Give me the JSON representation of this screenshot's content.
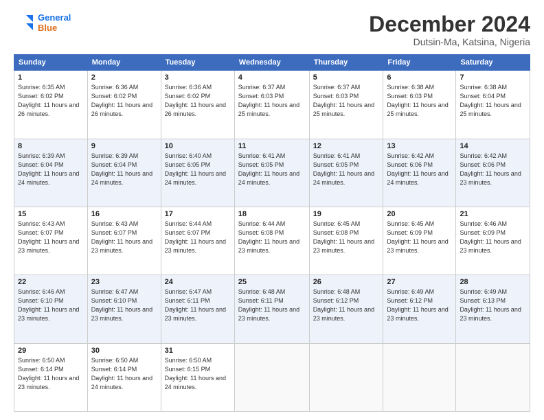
{
  "header": {
    "logo_line1": "General",
    "logo_line2": "Blue",
    "month": "December 2024",
    "location": "Dutsin-Ma, Katsina, Nigeria"
  },
  "days_of_week": [
    "Sunday",
    "Monday",
    "Tuesday",
    "Wednesday",
    "Thursday",
    "Friday",
    "Saturday"
  ],
  "weeks": [
    [
      {
        "day": "1",
        "sunrise": "6:35 AM",
        "sunset": "6:02 PM",
        "daylight": "11 hours and 26 minutes."
      },
      {
        "day": "2",
        "sunrise": "6:36 AM",
        "sunset": "6:02 PM",
        "daylight": "11 hours and 26 minutes."
      },
      {
        "day": "3",
        "sunrise": "6:36 AM",
        "sunset": "6:02 PM",
        "daylight": "11 hours and 26 minutes."
      },
      {
        "day": "4",
        "sunrise": "6:37 AM",
        "sunset": "6:03 PM",
        "daylight": "11 hours and 25 minutes."
      },
      {
        "day": "5",
        "sunrise": "6:37 AM",
        "sunset": "6:03 PM",
        "daylight": "11 hours and 25 minutes."
      },
      {
        "day": "6",
        "sunrise": "6:38 AM",
        "sunset": "6:03 PM",
        "daylight": "11 hours and 25 minutes."
      },
      {
        "day": "7",
        "sunrise": "6:38 AM",
        "sunset": "6:04 PM",
        "daylight": "11 hours and 25 minutes."
      }
    ],
    [
      {
        "day": "8",
        "sunrise": "6:39 AM",
        "sunset": "6:04 PM",
        "daylight": "11 hours and 24 minutes."
      },
      {
        "day": "9",
        "sunrise": "6:39 AM",
        "sunset": "6:04 PM",
        "daylight": "11 hours and 24 minutes."
      },
      {
        "day": "10",
        "sunrise": "6:40 AM",
        "sunset": "6:05 PM",
        "daylight": "11 hours and 24 minutes."
      },
      {
        "day": "11",
        "sunrise": "6:41 AM",
        "sunset": "6:05 PM",
        "daylight": "11 hours and 24 minutes."
      },
      {
        "day": "12",
        "sunrise": "6:41 AM",
        "sunset": "6:05 PM",
        "daylight": "11 hours and 24 minutes."
      },
      {
        "day": "13",
        "sunrise": "6:42 AM",
        "sunset": "6:06 PM",
        "daylight": "11 hours and 24 minutes."
      },
      {
        "day": "14",
        "sunrise": "6:42 AM",
        "sunset": "6:06 PM",
        "daylight": "11 hours and 23 minutes."
      }
    ],
    [
      {
        "day": "15",
        "sunrise": "6:43 AM",
        "sunset": "6:07 PM",
        "daylight": "11 hours and 23 minutes."
      },
      {
        "day": "16",
        "sunrise": "6:43 AM",
        "sunset": "6:07 PM",
        "daylight": "11 hours and 23 minutes."
      },
      {
        "day": "17",
        "sunrise": "6:44 AM",
        "sunset": "6:07 PM",
        "daylight": "11 hours and 23 minutes."
      },
      {
        "day": "18",
        "sunrise": "6:44 AM",
        "sunset": "6:08 PM",
        "daylight": "11 hours and 23 minutes."
      },
      {
        "day": "19",
        "sunrise": "6:45 AM",
        "sunset": "6:08 PM",
        "daylight": "11 hours and 23 minutes."
      },
      {
        "day": "20",
        "sunrise": "6:45 AM",
        "sunset": "6:09 PM",
        "daylight": "11 hours and 23 minutes."
      },
      {
        "day": "21",
        "sunrise": "6:46 AM",
        "sunset": "6:09 PM",
        "daylight": "11 hours and 23 minutes."
      }
    ],
    [
      {
        "day": "22",
        "sunrise": "6:46 AM",
        "sunset": "6:10 PM",
        "daylight": "11 hours and 23 minutes."
      },
      {
        "day": "23",
        "sunrise": "6:47 AM",
        "sunset": "6:10 PM",
        "daylight": "11 hours and 23 minutes."
      },
      {
        "day": "24",
        "sunrise": "6:47 AM",
        "sunset": "6:11 PM",
        "daylight": "11 hours and 23 minutes."
      },
      {
        "day": "25",
        "sunrise": "6:48 AM",
        "sunset": "6:11 PM",
        "daylight": "11 hours and 23 minutes."
      },
      {
        "day": "26",
        "sunrise": "6:48 AM",
        "sunset": "6:12 PM",
        "daylight": "11 hours and 23 minutes."
      },
      {
        "day": "27",
        "sunrise": "6:49 AM",
        "sunset": "6:12 PM",
        "daylight": "11 hours and 23 minutes."
      },
      {
        "day": "28",
        "sunrise": "6:49 AM",
        "sunset": "6:13 PM",
        "daylight": "11 hours and 23 minutes."
      }
    ],
    [
      {
        "day": "29",
        "sunrise": "6:50 AM",
        "sunset": "6:14 PM",
        "daylight": "11 hours and 23 minutes."
      },
      {
        "day": "30",
        "sunrise": "6:50 AM",
        "sunset": "6:14 PM",
        "daylight": "11 hours and 24 minutes."
      },
      {
        "day": "31",
        "sunrise": "6:50 AM",
        "sunset": "6:15 PM",
        "daylight": "11 hours and 24 minutes."
      },
      null,
      null,
      null,
      null
    ]
  ],
  "labels": {
    "sunrise": "Sunrise:",
    "sunset": "Sunset:",
    "daylight": "Daylight:"
  }
}
